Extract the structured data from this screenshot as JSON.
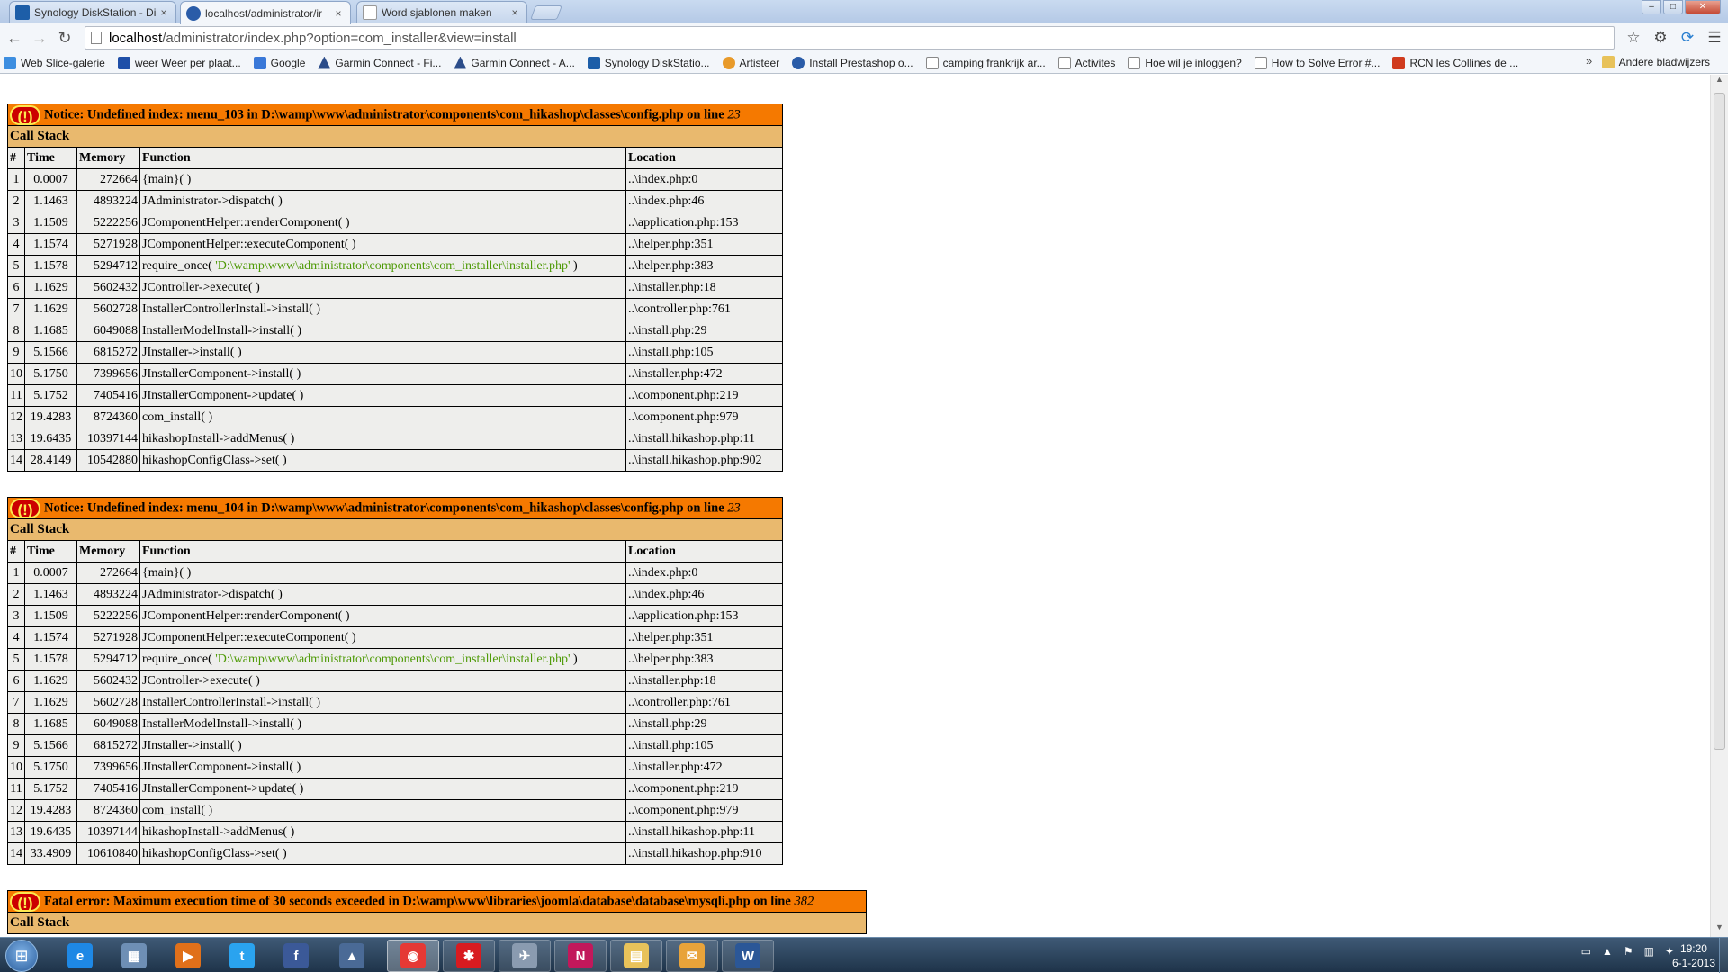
{
  "browser": {
    "tabs": [
      {
        "label": "Synology DiskStation - Di",
        "active": false,
        "favicon_color": "#1d5ea8"
      },
      {
        "label": "localhost/administrator/ir",
        "active": true,
        "favicon_color": "#2a5ca8"
      },
      {
        "label": "Word sjablonen maken",
        "active": false,
        "favicon_color": "#cccccc"
      }
    ],
    "tab_close_glyph": "×",
    "window_buttons": {
      "minimize": "–",
      "maximize": "□",
      "close": "✕"
    },
    "nav": {
      "back": "←",
      "forward": "→",
      "reload": "↻"
    },
    "address": {
      "host": "localhost",
      "rest": "/administrator/index.php?option=com_installer&view=install"
    },
    "toolbar_icons": {
      "star": "☆",
      "wrench": "⚙",
      "sync": "⟳",
      "menu": "☰"
    },
    "bookmarks": [
      {
        "label": "Web Slice-galerie",
        "icon_color": "#3d8ee0"
      },
      {
        "label": "weer Weer per plaat...",
        "icon_color": "#1f4fa8"
      },
      {
        "label": "Google",
        "icon_color": "#3a78d8"
      },
      {
        "label": "Garmin Connect - Fi...",
        "icon_color": "#2c4d8a"
      },
      {
        "label": "Garmin Connect - A...",
        "icon_color": "#2c4d8a"
      },
      {
        "label": "Synology DiskStatio...",
        "icon_color": "#1d5ea8"
      },
      {
        "label": "Artisteer",
        "icon_color": "#e89a2a"
      },
      {
        "label": "Install Prestashop o...",
        "icon_color": "#2a5ca8"
      },
      {
        "label": "camping frankrijk ar...",
        "icon_color": "#ffffff"
      },
      {
        "label": "Activites",
        "icon_color": "#ffffff"
      },
      {
        "label": "Hoe wil je inloggen?",
        "icon_color": "#ffffff"
      },
      {
        "label": "How to Solve Error #...",
        "icon_color": "#ffffff"
      },
      {
        "label": "RCN les Collines de ...",
        "icon_color": "#d03b1e"
      }
    ],
    "bookmarks_overflow": "»",
    "other_bookmarks": "Andere bladwijzers"
  },
  "errors": [
    {
      "type": "Notice",
      "message": "Notice: Undefined index: menu_103 in D:\\wamp\\www\\administrator\\components\\com_hikashop\\classes\\config.php on line ",
      "line": "23",
      "callstack_label": "Call Stack",
      "columns": [
        "#",
        "Time",
        "Memory",
        "Function",
        "Location"
      ],
      "rows": [
        {
          "n": "1",
          "time": "0.0007",
          "mem": "272664",
          "fn": "{main}( )",
          "loc": "..\\index.php:0"
        },
        {
          "n": "2",
          "time": "1.1463",
          "mem": "4893224",
          "fn": "JAdministrator->dispatch( )",
          "loc": "..\\index.php:46"
        },
        {
          "n": "3",
          "time": "1.1509",
          "mem": "5222256",
          "fn": "JComponentHelper::renderComponent( )",
          "loc": "..\\application.php:153"
        },
        {
          "n": "4",
          "time": "1.1574",
          "mem": "5271928",
          "fn": "JComponentHelper::executeComponent( )",
          "loc": "..\\helper.php:351"
        },
        {
          "n": "5",
          "time": "1.1578",
          "mem": "5294712",
          "fn": "require_once( ",
          "arg": "'D:\\wamp\\www\\administrator\\components\\com_installer\\installer.php'",
          "fn_end": " )",
          "loc": "..\\helper.php:383"
        },
        {
          "n": "6",
          "time": "1.1629",
          "mem": "5602432",
          "fn": "JController->execute( )",
          "loc": "..\\installer.php:18"
        },
        {
          "n": "7",
          "time": "1.1629",
          "mem": "5602728",
          "fn": "InstallerControllerInstall->install( )",
          "loc": "..\\controller.php:761"
        },
        {
          "n": "8",
          "time": "1.1685",
          "mem": "6049088",
          "fn": "InstallerModelInstall->install( )",
          "loc": "..\\install.php:29"
        },
        {
          "n": "9",
          "time": "5.1566",
          "mem": "6815272",
          "fn": "JInstaller->install( )",
          "loc": "..\\install.php:105"
        },
        {
          "n": "10",
          "time": "5.1750",
          "mem": "7399656",
          "fn": "JInstallerComponent->install( )",
          "loc": "..\\installer.php:472"
        },
        {
          "n": "11",
          "time": "5.1752",
          "mem": "7405416",
          "fn": "JInstallerComponent->update( )",
          "loc": "..\\component.php:219"
        },
        {
          "n": "12",
          "time": "19.4283",
          "mem": "8724360",
          "fn": "com_install( )",
          "loc": "..\\component.php:979"
        },
        {
          "n": "13",
          "time": "19.6435",
          "mem": "10397144",
          "fn": "hikashopInstall->addMenus( )",
          "loc": "..\\install.hikashop.php:11"
        },
        {
          "n": "14",
          "time": "28.4149",
          "mem": "10542880",
          "fn": "hikashopConfigClass->set( )",
          "loc": "..\\install.hikashop.php:902"
        }
      ]
    },
    {
      "type": "Notice",
      "message": "Notice: Undefined index: menu_104 in D:\\wamp\\www\\administrator\\components\\com_hikashop\\classes\\config.php on line ",
      "line": "23",
      "callstack_label": "Call Stack",
      "columns": [
        "#",
        "Time",
        "Memory",
        "Function",
        "Location"
      ],
      "rows": [
        {
          "n": "1",
          "time": "0.0007",
          "mem": "272664",
          "fn": "{main}( )",
          "loc": "..\\index.php:0"
        },
        {
          "n": "2",
          "time": "1.1463",
          "mem": "4893224",
          "fn": "JAdministrator->dispatch( )",
          "loc": "..\\index.php:46"
        },
        {
          "n": "3",
          "time": "1.1509",
          "mem": "5222256",
          "fn": "JComponentHelper::renderComponent( )",
          "loc": "..\\application.php:153"
        },
        {
          "n": "4",
          "time": "1.1574",
          "mem": "5271928",
          "fn": "JComponentHelper::executeComponent( )",
          "loc": "..\\helper.php:351"
        },
        {
          "n": "5",
          "time": "1.1578",
          "mem": "5294712",
          "fn": "require_once( ",
          "arg": "'D:\\wamp\\www\\administrator\\components\\com_installer\\installer.php'",
          "fn_end": " )",
          "loc": "..\\helper.php:383"
        },
        {
          "n": "6",
          "time": "1.1629",
          "mem": "5602432",
          "fn": "JController->execute( )",
          "loc": "..\\installer.php:18"
        },
        {
          "n": "7",
          "time": "1.1629",
          "mem": "5602728",
          "fn": "InstallerControllerInstall->install( )",
          "loc": "..\\controller.php:761"
        },
        {
          "n": "8",
          "time": "1.1685",
          "mem": "6049088",
          "fn": "InstallerModelInstall->install( )",
          "loc": "..\\install.php:29"
        },
        {
          "n": "9",
          "time": "5.1566",
          "mem": "6815272",
          "fn": "JInstaller->install( )",
          "loc": "..\\install.php:105"
        },
        {
          "n": "10",
          "time": "5.1750",
          "mem": "7399656",
          "fn": "JInstallerComponent->install( )",
          "loc": "..\\installer.php:472"
        },
        {
          "n": "11",
          "time": "5.1752",
          "mem": "7405416",
          "fn": "JInstallerComponent->update( )",
          "loc": "..\\component.php:219"
        },
        {
          "n": "12",
          "time": "19.4283",
          "mem": "8724360",
          "fn": "com_install( )",
          "loc": "..\\component.php:979"
        },
        {
          "n": "13",
          "time": "19.6435",
          "mem": "10397144",
          "fn": "hikashopInstall->addMenus( )",
          "loc": "..\\install.hikashop.php:11"
        },
        {
          "n": "14",
          "time": "33.4909",
          "mem": "10610840",
          "fn": "hikashopConfigClass->set( )",
          "loc": "..\\install.hikashop.php:910"
        }
      ]
    },
    {
      "type": "Fatal error",
      "message": "Fatal error: Maximum execution time of 30 seconds exceeded in D:\\wamp\\www\\libraries\\joomla\\database\\database\\mysqli.php on line ",
      "line": "382",
      "callstack_label": "Call Stack",
      "columns": [],
      "rows": []
    }
  ],
  "error_icon": "(!)",
  "taskbar": {
    "start_glyph": "⊞",
    "apps": [
      {
        "name": "ie",
        "glyph": "e",
        "color": "#1e88e5"
      },
      {
        "name": "calculator",
        "glyph": "▦",
        "color": "#6e8fb5"
      },
      {
        "name": "media-player",
        "glyph": "▶",
        "color": "#e0701a"
      },
      {
        "name": "twitter",
        "glyph": "t",
        "color": "#2aa3ef"
      },
      {
        "name": "facebook",
        "glyph": "f",
        "color": "#3b5998"
      },
      {
        "name": "garmin",
        "glyph": "▲",
        "color": "#4a6a96"
      },
      {
        "name": "chrome",
        "glyph": "◉",
        "color": "#e53935"
      },
      {
        "name": "paint",
        "glyph": "✱",
        "color": "#d81b20"
      },
      {
        "name": "airplane",
        "glyph": "✈",
        "color": "#8a9bb0"
      },
      {
        "name": "onenote",
        "glyph": "N",
        "color": "#c2185b"
      },
      {
        "name": "explorer",
        "glyph": "▤",
        "color": "#e8c25a"
      },
      {
        "name": "outlook",
        "glyph": "✉",
        "color": "#e8a33a"
      },
      {
        "name": "word",
        "glyph": "W",
        "color": "#2b5797"
      }
    ],
    "tray_icons": {
      "keyboard": "▭",
      "arrow": "▲",
      "flag": "⚑",
      "network": "▥",
      "speaker": "✦"
    },
    "time": "19:20",
    "date": "6-1-2013"
  }
}
